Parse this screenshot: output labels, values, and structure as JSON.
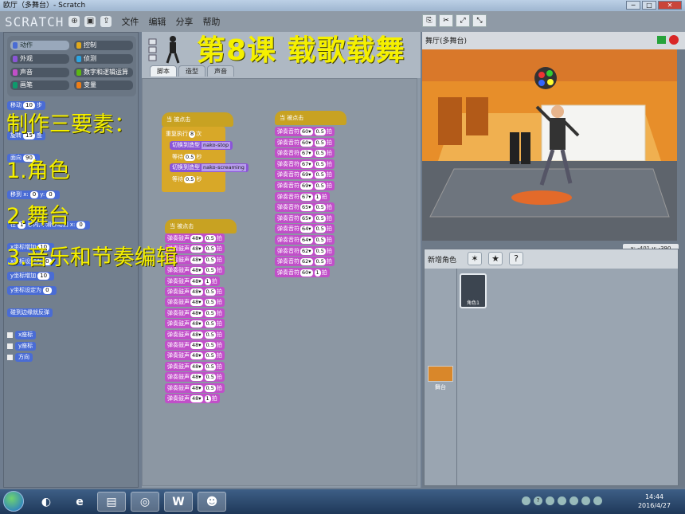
{
  "window": {
    "title": "欧厅（多舞台）- Scratch"
  },
  "menubar": {
    "logo": "SCRATCH",
    "menus": [
      "文件",
      "编辑",
      "分享",
      "帮助"
    ]
  },
  "palette": {
    "categories": [
      {
        "label": "动作",
        "color": "#4a6cd4",
        "selected": true
      },
      {
        "label": "控制",
        "color": "#e1a91a",
        "selected": false
      },
      {
        "label": "外观",
        "color": "#8a55d7",
        "selected": false
      },
      {
        "label": "侦测",
        "color": "#2ca5e2",
        "selected": false
      },
      {
        "label": "声音",
        "color": "#c14fc9",
        "selected": false
      },
      {
        "label": "数字和逻辑运算",
        "color": "#5cb712",
        "selected": false
      },
      {
        "label": "画笔",
        "color": "#0e9a6c",
        "selected": false
      },
      {
        "label": "变量",
        "color": "#ee7d16",
        "selected": false
      }
    ],
    "blocks": [
      {
        "text": "移动",
        "value": "10",
        "suffix": "步"
      },
      {
        "text": "旋转",
        "value": "15",
        "suffix": "度"
      },
      {
        "text": "面向",
        "value": "90",
        "suffix": ""
      },
      {
        "text": "移到 x:",
        "value": "0",
        "suffix": "y:",
        "value2": "0"
      },
      {
        "text": "在",
        "value": "1",
        "suffix": "秒内,平滑移动到 x:",
        "value2": "0"
      },
      {
        "text": "x坐标增加",
        "value": "10",
        "suffix": ""
      },
      {
        "text": "x坐标设定为",
        "value": "0",
        "suffix": ""
      },
      {
        "text": "y坐标增加",
        "value": "10",
        "suffix": ""
      },
      {
        "text": "y坐标设定为",
        "value": "0",
        "suffix": ""
      },
      {
        "text": "碰到边缘就反弹",
        "value": "",
        "suffix": ""
      }
    ],
    "reporters": [
      "x座标",
      "y座标",
      "方向"
    ]
  },
  "script_tabs": [
    "脚本",
    "造型",
    "声音"
  ],
  "scripts": {
    "hat_label": "当 被点击",
    "repeat_label": "重复执行",
    "repeat_count": "8",
    "repeat_suffix": "次",
    "switch_label": "切换到造型",
    "costume1": "nako-stop",
    "costume2": "nako-screaming",
    "wait_label": "等待",
    "wait_value": "0.5",
    "wait_suffix": "秒",
    "drum_label": "弹奏鼓声",
    "note_label": "弹奏音符",
    "beat_suffix": "拍",
    "drum_value": "48▾",
    "drum_beats": [
      "0.5",
      "0.5",
      "0.5",
      "0.5",
      "1",
      "0.5",
      "0.5",
      "0.5",
      "0.5",
      "0.5",
      "0.5",
      "0.5",
      "0.5",
      "0.5",
      "0.5",
      "1"
    ],
    "notes": [
      {
        "note": "60▾",
        "beat": "0.5"
      },
      {
        "note": "60▾",
        "beat": "0.5"
      },
      {
        "note": "67▾",
        "beat": "0.5"
      },
      {
        "note": "67▾",
        "beat": "0.5"
      },
      {
        "note": "69▾",
        "beat": "0.5"
      },
      {
        "note": "69▾",
        "beat": "0.5"
      },
      {
        "note": "67▾",
        "beat": "1"
      },
      {
        "note": "65▾",
        "beat": "0.5"
      },
      {
        "note": "65▾",
        "beat": "0.5"
      },
      {
        "note": "64▾",
        "beat": "0.5"
      },
      {
        "note": "64▾",
        "beat": "0.5"
      },
      {
        "note": "62▾",
        "beat": "0.5"
      },
      {
        "note": "62▾",
        "beat": "0.5"
      },
      {
        "note": "60▾",
        "beat": "1"
      }
    ]
  },
  "stage": {
    "title": "舞厅(多舞台)",
    "coords": "x: -401  y: -390"
  },
  "sprites": {
    "new_sprite_label": "新增角色",
    "items": [
      {
        "name": "角色1"
      }
    ],
    "stage_label": "舞台"
  },
  "overlay": {
    "title": "第8课 载歌载舞",
    "heading": "制作三要素：",
    "items": [
      "1.角色",
      "2.舞台",
      "3.音乐和节奏编辑"
    ]
  },
  "taskbar": {
    "time": "14:44",
    "date": "2016/4/27"
  }
}
